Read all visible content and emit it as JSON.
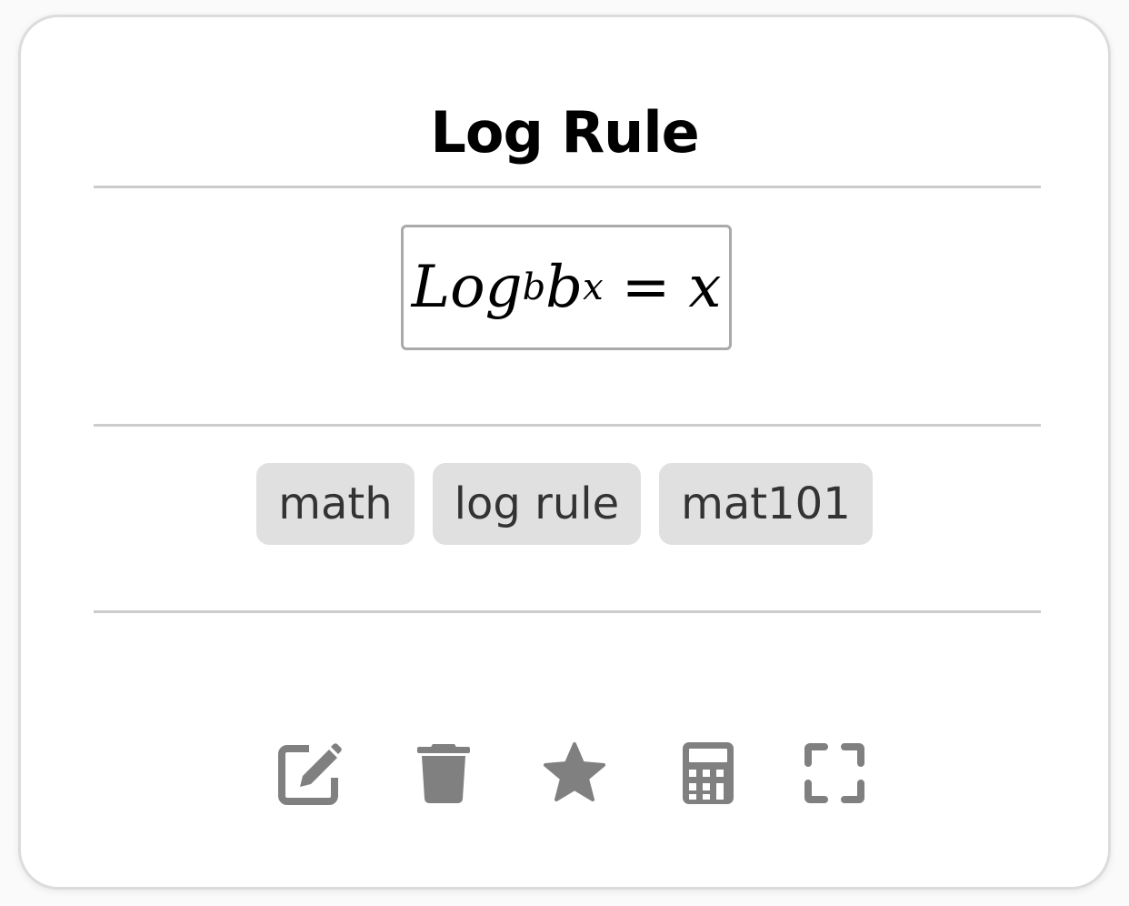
{
  "card": {
    "title": "Log Rule",
    "formula": {
      "base": "Log",
      "subscript": "b",
      "term": "b",
      "superscript": "x",
      "equals": "=",
      "result": "x"
    },
    "tags": [
      "math",
      "log rule",
      "mat101"
    ]
  },
  "actions": [
    {
      "name": "edit",
      "icon": "edit-icon"
    },
    {
      "name": "delete",
      "icon": "trash-icon"
    },
    {
      "name": "favorite",
      "icon": "star-icon"
    },
    {
      "name": "calculator",
      "icon": "calculator-icon"
    },
    {
      "name": "fullscreen",
      "icon": "expand-icon"
    }
  ],
  "colors": {
    "icon": "#808080",
    "tag_bg": "#e0e0e0",
    "tag_text": "#333333",
    "divider": "#cccccc",
    "formula_border": "#aaaaaa"
  }
}
